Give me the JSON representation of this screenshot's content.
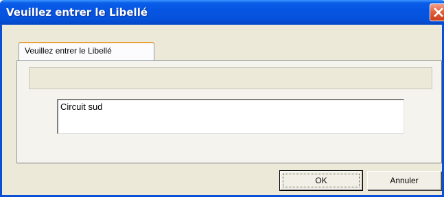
{
  "window": {
    "title": "Veuillez entrer le Libellé"
  },
  "tab": {
    "label": "Veuillez entrer le Libellé"
  },
  "header_field": {
    "value": ""
  },
  "libelle_input": {
    "value": "Circuit sud"
  },
  "buttons": {
    "ok_label": "OK",
    "cancel_label": "Annuler"
  },
  "icons": {
    "close": "close-icon"
  },
  "colors": {
    "titlebar": "#0654e2",
    "close_button": "#e2623f",
    "dialog_background": "#ece9d8",
    "tab_highlight": "#e8a33d"
  }
}
